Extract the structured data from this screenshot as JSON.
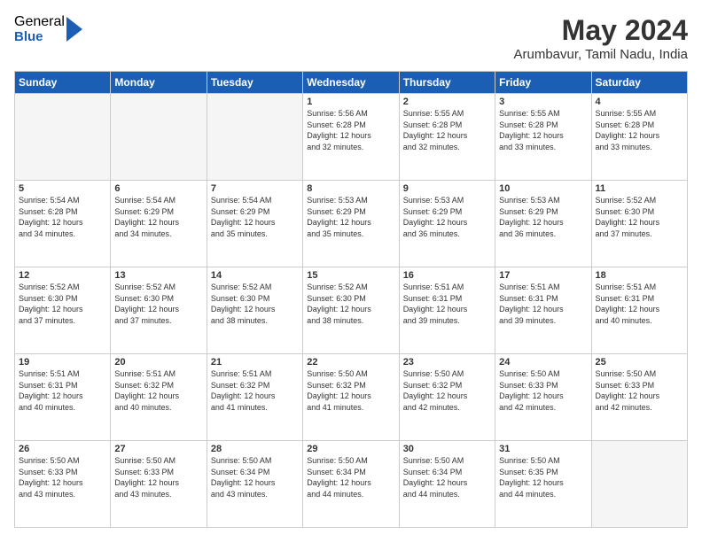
{
  "logo": {
    "general": "General",
    "blue": "Blue"
  },
  "title": "May 2024",
  "location": "Arumbavur, Tamil Nadu, India",
  "days_header": [
    "Sunday",
    "Monday",
    "Tuesday",
    "Wednesday",
    "Thursday",
    "Friday",
    "Saturday"
  ],
  "weeks": [
    [
      {
        "day": "",
        "info": ""
      },
      {
        "day": "",
        "info": ""
      },
      {
        "day": "",
        "info": ""
      },
      {
        "day": "1",
        "info": "Sunrise: 5:56 AM\nSunset: 6:28 PM\nDaylight: 12 hours\nand 32 minutes."
      },
      {
        "day": "2",
        "info": "Sunrise: 5:55 AM\nSunset: 6:28 PM\nDaylight: 12 hours\nand 32 minutes."
      },
      {
        "day": "3",
        "info": "Sunrise: 5:55 AM\nSunset: 6:28 PM\nDaylight: 12 hours\nand 33 minutes."
      },
      {
        "day": "4",
        "info": "Sunrise: 5:55 AM\nSunset: 6:28 PM\nDaylight: 12 hours\nand 33 minutes."
      }
    ],
    [
      {
        "day": "5",
        "info": "Sunrise: 5:54 AM\nSunset: 6:28 PM\nDaylight: 12 hours\nand 34 minutes."
      },
      {
        "day": "6",
        "info": "Sunrise: 5:54 AM\nSunset: 6:29 PM\nDaylight: 12 hours\nand 34 minutes."
      },
      {
        "day": "7",
        "info": "Sunrise: 5:54 AM\nSunset: 6:29 PM\nDaylight: 12 hours\nand 35 minutes."
      },
      {
        "day": "8",
        "info": "Sunrise: 5:53 AM\nSunset: 6:29 PM\nDaylight: 12 hours\nand 35 minutes."
      },
      {
        "day": "9",
        "info": "Sunrise: 5:53 AM\nSunset: 6:29 PM\nDaylight: 12 hours\nand 36 minutes."
      },
      {
        "day": "10",
        "info": "Sunrise: 5:53 AM\nSunset: 6:29 PM\nDaylight: 12 hours\nand 36 minutes."
      },
      {
        "day": "11",
        "info": "Sunrise: 5:52 AM\nSunset: 6:30 PM\nDaylight: 12 hours\nand 37 minutes."
      }
    ],
    [
      {
        "day": "12",
        "info": "Sunrise: 5:52 AM\nSunset: 6:30 PM\nDaylight: 12 hours\nand 37 minutes."
      },
      {
        "day": "13",
        "info": "Sunrise: 5:52 AM\nSunset: 6:30 PM\nDaylight: 12 hours\nand 37 minutes."
      },
      {
        "day": "14",
        "info": "Sunrise: 5:52 AM\nSunset: 6:30 PM\nDaylight: 12 hours\nand 38 minutes."
      },
      {
        "day": "15",
        "info": "Sunrise: 5:52 AM\nSunset: 6:30 PM\nDaylight: 12 hours\nand 38 minutes."
      },
      {
        "day": "16",
        "info": "Sunrise: 5:51 AM\nSunset: 6:31 PM\nDaylight: 12 hours\nand 39 minutes."
      },
      {
        "day": "17",
        "info": "Sunrise: 5:51 AM\nSunset: 6:31 PM\nDaylight: 12 hours\nand 39 minutes."
      },
      {
        "day": "18",
        "info": "Sunrise: 5:51 AM\nSunset: 6:31 PM\nDaylight: 12 hours\nand 40 minutes."
      }
    ],
    [
      {
        "day": "19",
        "info": "Sunrise: 5:51 AM\nSunset: 6:31 PM\nDaylight: 12 hours\nand 40 minutes."
      },
      {
        "day": "20",
        "info": "Sunrise: 5:51 AM\nSunset: 6:32 PM\nDaylight: 12 hours\nand 40 minutes."
      },
      {
        "day": "21",
        "info": "Sunrise: 5:51 AM\nSunset: 6:32 PM\nDaylight: 12 hours\nand 41 minutes."
      },
      {
        "day": "22",
        "info": "Sunrise: 5:50 AM\nSunset: 6:32 PM\nDaylight: 12 hours\nand 41 minutes."
      },
      {
        "day": "23",
        "info": "Sunrise: 5:50 AM\nSunset: 6:32 PM\nDaylight: 12 hours\nand 42 minutes."
      },
      {
        "day": "24",
        "info": "Sunrise: 5:50 AM\nSunset: 6:33 PM\nDaylight: 12 hours\nand 42 minutes."
      },
      {
        "day": "25",
        "info": "Sunrise: 5:50 AM\nSunset: 6:33 PM\nDaylight: 12 hours\nand 42 minutes."
      }
    ],
    [
      {
        "day": "26",
        "info": "Sunrise: 5:50 AM\nSunset: 6:33 PM\nDaylight: 12 hours\nand 43 minutes."
      },
      {
        "day": "27",
        "info": "Sunrise: 5:50 AM\nSunset: 6:33 PM\nDaylight: 12 hours\nand 43 minutes."
      },
      {
        "day": "28",
        "info": "Sunrise: 5:50 AM\nSunset: 6:34 PM\nDaylight: 12 hours\nand 43 minutes."
      },
      {
        "day": "29",
        "info": "Sunrise: 5:50 AM\nSunset: 6:34 PM\nDaylight: 12 hours\nand 44 minutes."
      },
      {
        "day": "30",
        "info": "Sunrise: 5:50 AM\nSunset: 6:34 PM\nDaylight: 12 hours\nand 44 minutes."
      },
      {
        "day": "31",
        "info": "Sunrise: 5:50 AM\nSunset: 6:35 PM\nDaylight: 12 hours\nand 44 minutes."
      },
      {
        "day": "",
        "info": ""
      }
    ]
  ]
}
